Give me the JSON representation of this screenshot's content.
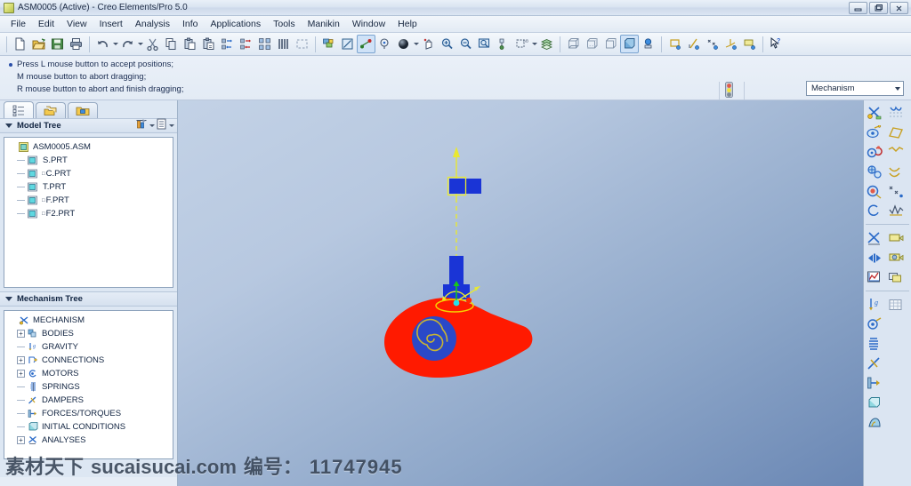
{
  "window": {
    "title": "ASM0005 (Active) - Creo Elements/Pro 5.0",
    "app_icon": "assembly-icon",
    "controls": [
      {
        "name": "minimize-button",
        "glyph": "minimize-icon"
      },
      {
        "name": "maximize-button",
        "glyph": "maximize-icon"
      },
      {
        "name": "close-button",
        "glyph": "close-icon"
      }
    ]
  },
  "menubar": {
    "items": [
      {
        "label": "File"
      },
      {
        "label": "Edit"
      },
      {
        "label": "View"
      },
      {
        "label": "Insert"
      },
      {
        "label": "Analysis"
      },
      {
        "label": "Info"
      },
      {
        "label": "Applications"
      },
      {
        "label": "Tools"
      },
      {
        "label": "Manikin"
      },
      {
        "label": "Window"
      },
      {
        "label": "Help"
      }
    ]
  },
  "toolbar": {
    "groups": [
      {
        "name": "file-group",
        "tools": [
          {
            "name": "new-file-icon"
          },
          {
            "name": "open-file-icon"
          },
          {
            "name": "save-icon"
          },
          {
            "name": "print-icon"
          }
        ]
      },
      {
        "name": "edit-group",
        "tools": [
          {
            "name": "undo-icon",
            "dropdown": true
          },
          {
            "name": "redo-icon",
            "dropdown": true
          },
          {
            "name": "cut-icon"
          },
          {
            "name": "copy-icon"
          },
          {
            "name": "paste-icon"
          },
          {
            "name": "paste-special-icon"
          },
          {
            "name": "regenerate-icon"
          },
          {
            "name": "regenerate-manual-icon"
          },
          {
            "name": "select-group-icon"
          },
          {
            "name": "find-icon"
          },
          {
            "name": "select-box-icon"
          }
        ]
      },
      {
        "name": "view-group",
        "tools": [
          {
            "name": "layer-icon"
          },
          {
            "name": "sketch-view-icon"
          },
          {
            "name": "datum-plane-display-icon",
            "active": true
          },
          {
            "name": "spin-center-icon"
          },
          {
            "name": "shading-icon",
            "dropdown": true
          },
          {
            "name": "pan-icon"
          },
          {
            "name": "zoom-in-icon"
          },
          {
            "name": "zoom-out-icon"
          },
          {
            "name": "refit-icon"
          },
          {
            "name": "view-manager-icon"
          },
          {
            "name": "annotation-icon",
            "dropdown": true
          },
          {
            "name": "layers-stack-icon"
          }
        ]
      },
      {
        "name": "display-group",
        "tools": [
          {
            "name": "wireframe-icon"
          },
          {
            "name": "hidden-line-icon"
          },
          {
            "name": "no-hidden-icon"
          },
          {
            "name": "shading-display-icon",
            "active": true
          },
          {
            "name": "light-icon"
          }
        ]
      },
      {
        "name": "datum-group",
        "tools": [
          {
            "name": "datum-plane-icon"
          },
          {
            "name": "datum-axis-icon"
          },
          {
            "name": "datum-point-icon"
          },
          {
            "name": "coordinate-system-icon"
          },
          {
            "name": "datum-tag-icon"
          }
        ]
      },
      {
        "name": "help-group",
        "tools": [
          {
            "name": "context-help-icon"
          }
        ]
      }
    ]
  },
  "messages": {
    "lines": [
      {
        "text": "Press L mouse button to accept positions;",
        "bullet": true
      },
      {
        "text": "M mouse button to abort dragging;",
        "bullet": false
      },
      {
        "text": "R mouse button to abort and finish dragging;",
        "bullet": false
      }
    ]
  },
  "status_row": {
    "traffic_light_icon": "regeneration-status-icon",
    "mode_select": {
      "name": "mechanism-mode-select",
      "value": "Mechanism"
    }
  },
  "left_panel": {
    "tabs": [
      {
        "name": "tab-model-tree",
        "icon": "model-tree-icon",
        "active": true
      },
      {
        "name": "tab-layer-tree",
        "icon": "layers-icon",
        "active": false
      },
      {
        "name": "tab-folder-browser",
        "icon": "folder-browser-icon",
        "active": false
      }
    ],
    "model_tree": {
      "title": "Model Tree",
      "header_tools": [
        {
          "name": "tree-filter-button",
          "icon": "filter-icon",
          "dropdown": true
        },
        {
          "name": "tree-settings-button",
          "icon": "settings-list-icon",
          "dropdown": true
        }
      ],
      "root": {
        "label": "ASM0005.ASM",
        "icon": "assembly-icon"
      },
      "nodes": [
        {
          "label": "S.PRT",
          "icon": "part-icon",
          "marker": ""
        },
        {
          "label": "C.PRT",
          "icon": "part-icon",
          "marker": "□"
        },
        {
          "label": "T.PRT",
          "icon": "part-icon",
          "marker": ""
        },
        {
          "label": "F.PRT",
          "icon": "part-icon",
          "marker": "□"
        },
        {
          "label": "F2.PRT",
          "icon": "part-icon",
          "marker": "□"
        }
      ]
    },
    "mechanism_tree": {
      "title": "Mechanism Tree",
      "root": {
        "label": "MECHANISM",
        "icon": "mechanism-icon"
      },
      "nodes": [
        {
          "label": "BODIES",
          "icon": "bodies-icon",
          "expandable": true
        },
        {
          "label": "GRAVITY",
          "icon": "gravity-icon",
          "expandable": false
        },
        {
          "label": "CONNECTIONS",
          "icon": "connections-icon",
          "expandable": true
        },
        {
          "label": "MOTORS",
          "icon": "motors-icon",
          "expandable": true
        },
        {
          "label": "SPRINGS",
          "icon": "springs-icon",
          "expandable": false
        },
        {
          "label": "DAMPERS",
          "icon": "dampers-icon",
          "expandable": false
        },
        {
          "label": "FORCES/TORQUES",
          "icon": "forces-torques-icon",
          "expandable": false
        },
        {
          "label": "INITIAL CONDITIONS",
          "icon": "initial-conditions-icon",
          "expandable": false
        },
        {
          "label": "ANALYSES",
          "icon": "analyses-icon",
          "expandable": true
        }
      ]
    }
  },
  "right_toolbar": {
    "groups": [
      {
        "name": "mechanism-entities-group",
        "tools": [
          {
            "name": "define-body-icon"
          },
          {
            "name": "drag-packaged-icon"
          },
          {
            "name": "cam-follower-icon"
          },
          {
            "name": "slot-follower-icon"
          },
          {
            "name": "gear-pair-icon"
          },
          {
            "name": "belt-icon"
          },
          {
            "name": "servo-motor-icon"
          },
          {
            "name": "3d-contact-icon"
          },
          {
            "name": "point-set-icon"
          },
          {
            "name": "force-motor-icon"
          },
          {
            "name": "measure-icon"
          }
        ]
      },
      {
        "name": "analysis-group",
        "tools": [
          {
            "name": "analysis-definition-icon"
          },
          {
            "name": "playback-icon"
          },
          {
            "name": "frame-step-icon"
          },
          {
            "name": "results-snapshot-icon"
          },
          {
            "name": "measure-results-icon"
          },
          {
            "name": "trace-curve-icon"
          }
        ]
      },
      {
        "name": "dynamics-group",
        "tools": [
          {
            "name": "gravity-icon"
          },
          {
            "name": "initial-condition-icon"
          },
          {
            "name": "spring-icon"
          },
          {
            "name": "damper-icon"
          },
          {
            "name": "force-torque-icon"
          },
          {
            "name": "mass-properties-icon"
          },
          {
            "name": "bushing-load-icon"
          },
          {
            "name": "grid-table-icon"
          }
        ]
      }
    ]
  },
  "viewport": {
    "name": "graphics-window",
    "background_top": "#c3d2e6",
    "background_bottom": "#6a87b4",
    "model": {
      "name": "cam-follower-assembly",
      "cam_color": "#ff1a00",
      "follower_color": "#1a34d6",
      "hub_color": "#2a49c8",
      "spiral_color": "#c8b432",
      "drag_line_color": "#e8e832",
      "highlight_color": "#f5d400"
    }
  },
  "watermark": {
    "site_cn": "素材天下",
    "site": "sucaisucai.com",
    "label": "编号：",
    "number": "11747945"
  }
}
